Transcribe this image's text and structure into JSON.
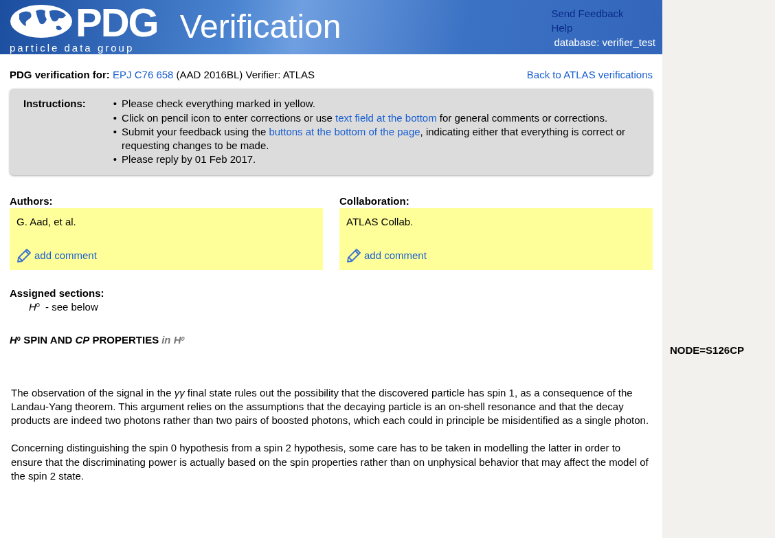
{
  "header": {
    "logo_text": "PDG",
    "logo_subtitle": "particle data group",
    "title": "Verification",
    "links": [
      "Send Feedback",
      "Help"
    ],
    "database": "database: verifier_test"
  },
  "verification": {
    "label": "PDG verification for:",
    "reference": "EPJ C76 658",
    "key": "(AAD 2016BL)",
    "verifier": "Verifier: ATLAS",
    "back_link": "Back to ATLAS verifications"
  },
  "instructions": {
    "label": "Instructions:",
    "items": [
      {
        "bullet": "•",
        "parts": [
          {
            "text": "Please check everything marked in yellow.",
            "kind": "text"
          }
        ]
      },
      {
        "bullet": "•",
        "parts": [
          {
            "text": "Click on pencil icon to enter corrections or use ",
            "kind": "text"
          },
          {
            "text": "text field at the bottom",
            "kind": "link"
          },
          {
            "text": " for general comments or corrections.",
            "kind": "text"
          }
        ]
      },
      {
        "bullet": "•",
        "parts": [
          {
            "text": "Submit your feedback using the ",
            "kind": "text"
          },
          {
            "text": "buttons at the bottom of the page",
            "kind": "link"
          },
          {
            "text": ", indicating either that everything is correct or requesting changes to be made.",
            "kind": "text"
          }
        ]
      },
      {
        "bullet": "•",
        "parts": [
          {
            "text": "Please reply by 01 Feb 2017.",
            "kind": "text"
          }
        ]
      }
    ]
  },
  "fields": [
    {
      "label": "Authors:",
      "value": "G. Aad, et al.",
      "comment": "add comment"
    },
    {
      "label": "Collaboration:",
      "value": "ATLAS Collab.",
      "comment": "add comment"
    }
  ],
  "assigned": {
    "label": "Assigned sections:",
    "items": [
      {
        "section": "*H*$^{0}$",
        "note": "- see below"
      }
    ]
  },
  "section": {
    "title": "*H*$^{0}$ SPIN AND *CP* PROPERTIES",
    "context": "in *H*$^{0}$",
    "node": "NODE=S126CP"
  },
  "paragraphs": [
    "The observation of the signal in the *γγ* final state rules out the possibility that the discovered particle has spin 1, as a consequence of the Landau-Yang theorem. This argument relies on the assumptions that the decaying particle is an on-shell resonance and that the decay products are indeed two photons rather than two pairs of boosted photons, which each could in principle be misidentified as a single photon.",
    "Concerning distinguishing the spin 0 hypothesis from a spin 2 hypothesis, some care has to be taken in modelling the latter in order to ensure that the discriminating power is actually based on the spin properties rather than on unphysical behavior that may affect the model of the spin 2 state."
  ]
}
